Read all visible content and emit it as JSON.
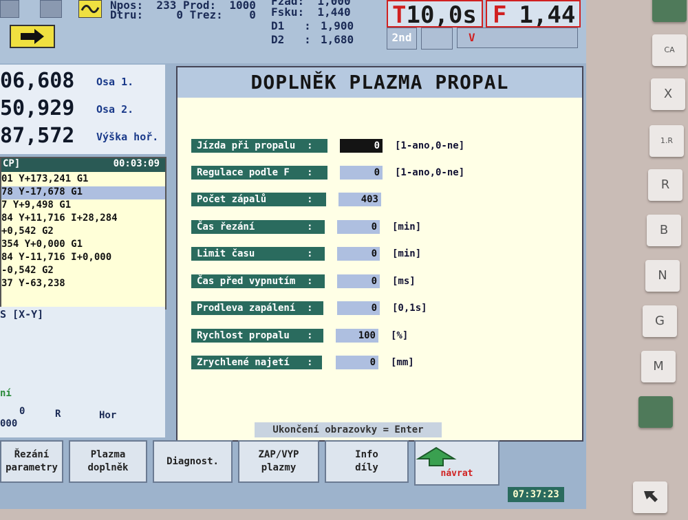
{
  "top": {
    "left_line1": "Npos:  233 Prod:  1000",
    "left_line2": "Dtru:     0 Trez:    0",
    "right_line1": "Fzad:  1,000",
    "right_line2": "Fsku:  1,440",
    "d1_label": "D1   :",
    "d1_value": "1,900",
    "d2_label": "D2   :",
    "d2_value": "1,680",
    "big_time": "10,0s",
    "big_time_prefix": "T",
    "big_f_prefix": "F",
    "big_f": "1,44",
    "second_label": "2nd",
    "v_label": "V"
  },
  "coords": {
    "axis1_value": "06,608",
    "axis1_label": "Osa 1.",
    "axis2_value": "50,929",
    "axis2_label": "Osa 2.",
    "height_value": "87,572",
    "height_label": "Výška hoř."
  },
  "program": {
    "header_name": "CP]",
    "header_time": "00:03:09",
    "lines": [
      "01 Y+173,241 G1",
      "78 Y-17,678 G1",
      "7 Y+9,498 G1",
      "84 Y+11,716 I+28,284",
      "+0,542 G2",
      "354 Y+0,000 G1",
      "84 Y-11,716 I+0,000",
      "-0,542 G2",
      "37 Y-63,238"
    ]
  },
  "left_bottom": {
    "plane": "S [X-Y]",
    "mode": "ní",
    "zero": "0",
    "r_label": "R",
    "hor_label": "Hor",
    "value": "000"
  },
  "dialog": {
    "title": "DOPLNĚK PLAZMA PROPAL",
    "params": [
      {
        "label": "Jízda při propalu  :",
        "value": "0",
        "unit": "[1-ano,0-ne]"
      },
      {
        "label": "Regulace podle F   :",
        "value": "0",
        "unit": "[1-ano,0-ne]"
      },
      {
        "label": "Počet zápalů       :",
        "value": "403",
        "unit": ""
      },
      {
        "label": "Čas řezání         :",
        "value": "0",
        "unit": "[min]"
      },
      {
        "label": "Limit času         :",
        "value": "0",
        "unit": "[min]"
      },
      {
        "label": "Čas před vypnutím  :",
        "value": "0",
        "unit": "[ms]"
      },
      {
        "label": "Prodleva zapálení  :",
        "value": "0",
        "unit": "[0,1s]"
      },
      {
        "label": "Rychlost propalu   :",
        "value": "100",
        "unit": "[%]"
      },
      {
        "label": "Zrychlené najetí   :",
        "value": "0",
        "unit": "[mm]"
      }
    ],
    "hint": "Ukončení obrazovky = Enter"
  },
  "softkeys": {
    "k1_l1": "Řezání",
    "k1_l2": "parametry",
    "k2_l1": "Plazma",
    "k2_l2": "doplněk",
    "k3_l1": "Diagnost.",
    "k4_l1": "ZAP/VYP",
    "k4_l2": "plazmy",
    "k5_l1": "Info",
    "k5_l2": "díly",
    "k6_l1": "návrat"
  },
  "clock": "07:37:23",
  "hardware_keys": {
    "ca": "CA",
    "x": "X",
    "r1": "1.R",
    "r": "R",
    "b": "B",
    "n": "N",
    "g": "G",
    "m": "M"
  },
  "colors": {
    "dialog_bg": "#ffffe6",
    "label_bg": "#2a6b5e",
    "value_bg": "#aebfe0",
    "accent_red": "#d02020",
    "arrow_yellow": "#f0e040",
    "return_green": "#3aa050"
  }
}
